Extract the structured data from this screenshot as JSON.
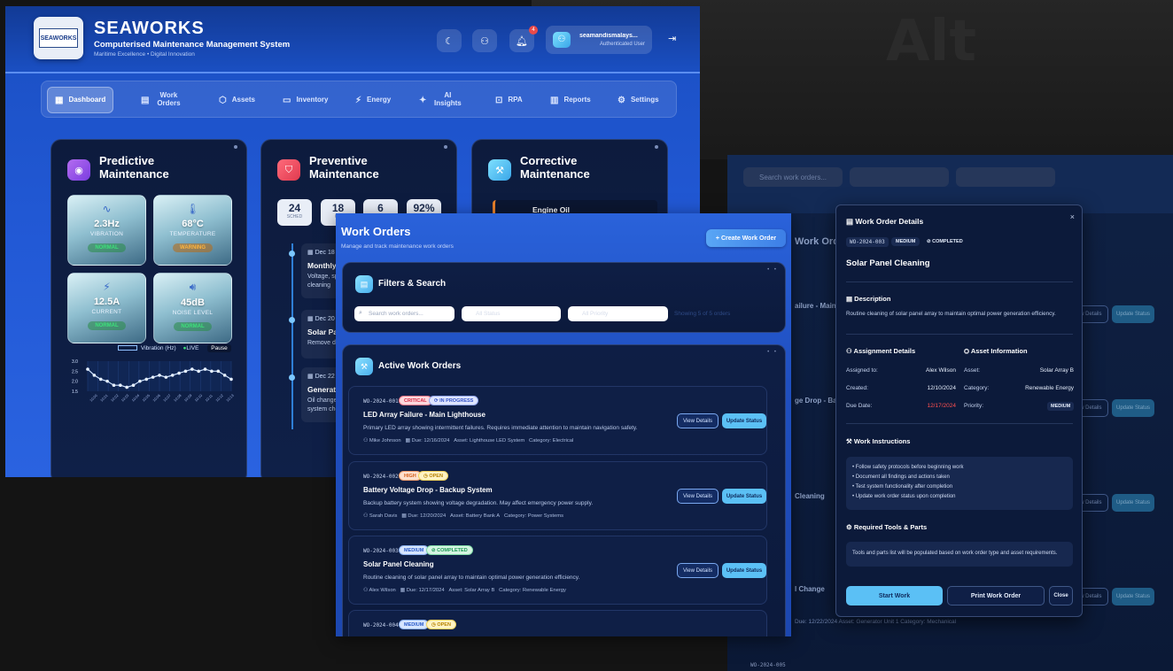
{
  "colors": {
    "accent": "#5bc0f5",
    "brand_blue": "#1a4fc2",
    "panel_dark": "#0c1a3a",
    "critical": "#d62b45",
    "warning": "#ffb43c",
    "normal": "#3ce07a"
  },
  "dashboard": {
    "logo_text": "SEAWORKS",
    "title": "SEAWORKS",
    "subtitle": "Computerised Maintenance Management System",
    "tagline": "Maritime Excellence • Digital Innovation",
    "header_icons": [
      "moon-icon",
      "users-icon",
      "bell-icon"
    ],
    "notification_count": "4",
    "user": {
      "name": "seamandismalays...",
      "role": "Authenticated User"
    },
    "nav": [
      {
        "label": "Dashboard",
        "icon": "dashboard-icon"
      },
      {
        "label": "Work Orders",
        "icon": "document-icon"
      },
      {
        "label": "Assets",
        "icon": "cube-icon"
      },
      {
        "label": "Inventory",
        "icon": "box-icon"
      },
      {
        "label": "Energy",
        "icon": "bolt-icon"
      },
      {
        "label": "AI Insights",
        "icon": "sparkle-icon"
      },
      {
        "label": "RPA",
        "icon": "robot-icon"
      },
      {
        "label": "Reports",
        "icon": "chart-icon"
      },
      {
        "label": "Settings",
        "icon": "gear-icon"
      }
    ],
    "predictive": {
      "title": "Predictive Maintenance",
      "metrics": [
        {
          "value": "2.3Hz",
          "label": "VIBRATION",
          "status": "NORMAL",
          "icon": "wave-icon"
        },
        {
          "value": "68°C",
          "label": "TEMPERATURE",
          "status": "WARNING",
          "icon": "thermometer-icon"
        },
        {
          "value": "12.5A",
          "label": "CURRENT",
          "status": "NORMAL",
          "icon": "bolt-icon"
        },
        {
          "value": "45dB",
          "label": "NOISE LEVEL",
          "status": "NORMAL",
          "icon": "speaker-icon"
        }
      ],
      "chart_legend": "Vibration (Hz)",
      "live_label": "LIVE",
      "pause_label": "Pause"
    },
    "preventive": {
      "title": "Preventive Maintenance",
      "stats": [
        {
          "value": "24",
          "label": "SCHED"
        },
        {
          "value": "18",
          "label": "CO"
        },
        {
          "value": "6",
          "label": ""
        },
        {
          "value": "92%",
          "label": ""
        }
      ],
      "items": [
        {
          "date": "Dec 18",
          "title": "Monthly",
          "desc": "Voltage, sp cleaning"
        },
        {
          "date": "Dec 20",
          "title": "Solar Pa",
          "desc": "Remove d"
        },
        {
          "date": "Dec 22",
          "title": "Generat",
          "desc": "Oil change system che"
        }
      ]
    },
    "corrective": {
      "title": "Corrective Maintenance",
      "item": "Engine Oil"
    }
  },
  "chart_data": {
    "type": "line",
    "title": "",
    "series": [
      {
        "name": "Vibration (Hz)",
        "values": [
          2.6,
          2.3,
          2.1,
          2.0,
          1.8,
          1.8,
          1.7,
          1.8,
          2.0,
          2.1,
          2.2,
          2.3,
          2.2,
          2.3,
          2.4,
          2.5,
          2.6,
          2.5,
          2.6,
          2.5,
          2.5,
          2.3,
          2.1
        ]
      }
    ],
    "ylim": [
      1.5,
      3.0
    ],
    "yticks": [
      "3.0",
      "2.5",
      "2.0",
      "1.5"
    ],
    "xticks": [
      "10:00",
      "10:01",
      "10:02",
      "10:03",
      "10:04",
      "10:05",
      "10:06",
      "10:07",
      "10:08",
      "10:09",
      "10:10",
      "10:11",
      "10:12",
      "10:13"
    ],
    "xlabel": "",
    "ylabel": "",
    "grid": true
  },
  "work_orders": {
    "title": "Work Orders",
    "subtitle": "Manage and track maintenance work orders",
    "create_label": "+ Create Work Order",
    "filters": {
      "title": "Filters & Search",
      "search_placeholder": "Search work orders...",
      "status_placeholder": "All Status",
      "priority_placeholder": "All Priority",
      "count": "Showing 5 of 5 orders"
    },
    "active_title": "Active Work Orders",
    "view_label": "View Details",
    "update_label": "Update Status",
    "orders": [
      {
        "code": "WO-2024-001",
        "priority": "CRITICAL",
        "status": "IN PROGRESS",
        "title": "LED Array Failure - Main Lighthouse",
        "desc": "Primary LED array showing intermittent failures. Requires immediate attention to maintain navigation safety.",
        "assignee": "Mike Johnson",
        "due": "Due: 12/16/2024",
        "asset": "Asset: Lighthouse LED System",
        "category": "Category: Electrical"
      },
      {
        "code": "WO-2024-002",
        "priority": "HIGH",
        "status": "OPEN",
        "title": "Battery Voltage Drop - Backup System",
        "desc": "Backup battery system showing voltage degradation. May affect emergency power supply.",
        "assignee": "Sarah Davis",
        "due": "Due: 12/20/2024",
        "asset": "Asset: Battery Bank A",
        "category": "Category: Power Systems"
      },
      {
        "code": "WO-2024-003",
        "priority": "MEDIUM",
        "status": "COMPLETED",
        "title": "Solar Panel Cleaning",
        "desc": "Routine cleaning of solar panel array to maintain optimal power generation efficiency.",
        "assignee": "Alex Wilson",
        "due": "Due: 12/17/2024",
        "asset": "Asset: Solar Array B",
        "category": "Category: Renewable Energy"
      },
      {
        "code": "WO-2024-004",
        "priority": "MEDIUM",
        "status": "OPEN",
        "title": "",
        "desc": "",
        "assignee": "",
        "due": "",
        "asset": "",
        "category": ""
      }
    ]
  },
  "background_list": {
    "search_placeholder": "Search work orders...",
    "row_title": "Work Orde",
    "row_snippets": [
      "ailure - Main Li",
      "ge Drop - Back",
      "Cleaning",
      "l Change"
    ],
    "code_last": "WO-2024-005",
    "view_label": "View Details",
    "update_label": "Update Status",
    "meta_last": "Due: 12/22/2024   Asset: Generator Unit 1   Category: Mechanical"
  },
  "modal": {
    "header": "Work Order Details",
    "code": "WO-2024-003",
    "priority": "MEDIUM",
    "status": "COMPLETED",
    "title": "Solar Panel Cleaning",
    "desc_heading": "Description",
    "desc": "Routine cleaning of solar panel array to maintain optimal power generation efficiency.",
    "assignment_heading": "Assignment Details",
    "asset_heading": "Asset Information",
    "assigned_k": "Assigned to:",
    "assigned_v": "Alex Wilson",
    "created_k": "Created:",
    "created_v": "12/10/2024",
    "due_k": "Due Date:",
    "due_v": "12/17/2024",
    "asset_k": "Asset:",
    "asset_v": "Solar Array B",
    "category_k": "Category:",
    "category_v": "Renewable Energy",
    "priority_k": "Priority:",
    "priority_v": "MEDIUM",
    "instructions_heading": "Work Instructions",
    "instructions": [
      "• Follow safety protocols before beginning work",
      "• Document all findings and actions taken",
      "• Test system functionality after completion",
      "• Update work order status upon completion"
    ],
    "tools_heading": "Required Tools & Parts",
    "tools_text": "Tools and parts list will be populated based on work order type and asset requirements.",
    "start_label": "Start Work",
    "print_label": "Print Work Order",
    "close_label": "Close"
  }
}
